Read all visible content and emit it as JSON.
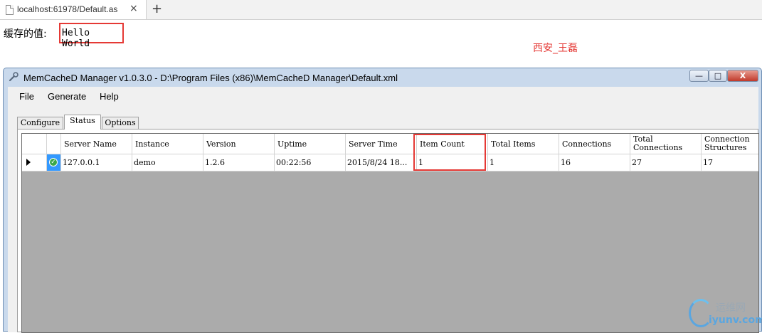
{
  "browser": {
    "tab_title": "localhost:61978/Default.as",
    "tab_close": "×",
    "new_tab": "+"
  },
  "page": {
    "cache_label": "缓存的值:",
    "cache_value": "Hello World",
    "author_note": "西安_王磊"
  },
  "window": {
    "title": "MemCacheD Manager v1.0.3.0 - D:\\Program Files (x86)\\MemCacheD Manager\\Default.xml",
    "controls": {
      "minimize": "—",
      "maximize": "□",
      "close": "X"
    }
  },
  "menu": [
    "File",
    "Generate",
    "Help"
  ],
  "tabs": [
    "Configure",
    "Status",
    "Options"
  ],
  "active_tab": "Status",
  "grid": {
    "columns": [
      "Server Name",
      "Instance",
      "Version",
      "Uptime",
      "Server Time",
      "Item Count",
      "Total Items",
      "Connections",
      "Total Connections",
      "Connection Structures"
    ],
    "rows": [
      [
        "127.0.0.1",
        "demo",
        "1.2.6",
        "00:22:56",
        "2015/8/24 18...",
        "1",
        "1",
        "16",
        "27",
        "17"
      ]
    ],
    "row_status": "ok"
  },
  "watermark": {
    "cn": "运维网",
    "en": "iyunv.com"
  },
  "icons": {
    "page": "page-icon",
    "app": "wrench-icon",
    "status": "check-circle-icon"
  },
  "colors": {
    "highlight": "#e53935",
    "selected_cell": "#3399ff",
    "grid_background": "#ababab"
  }
}
